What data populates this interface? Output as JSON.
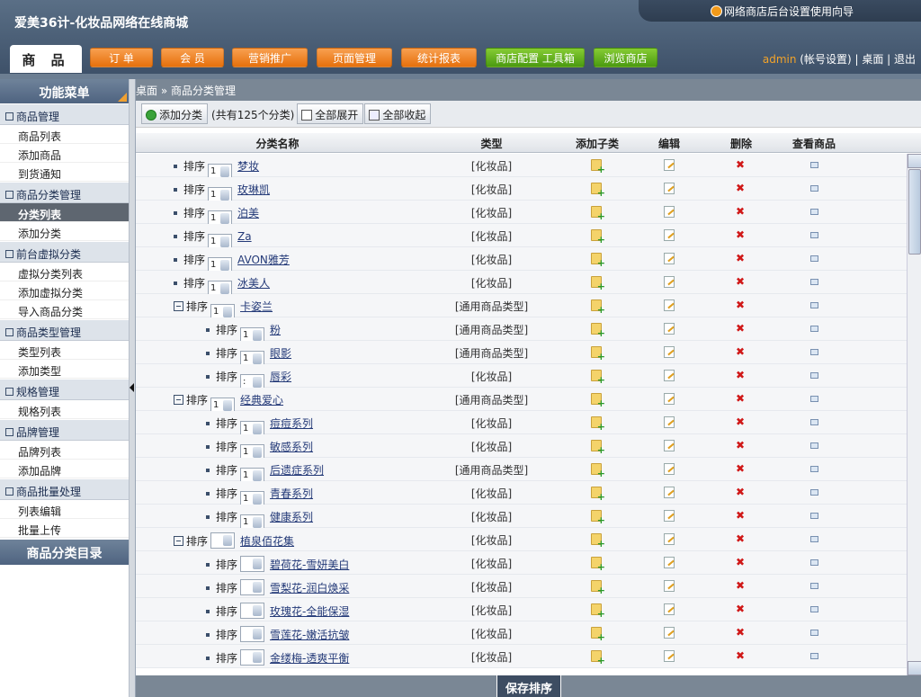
{
  "header": {
    "site_title": "爱美36计-化妆品网络在线商城",
    "guide_text": "网络商店后台设置使用向导",
    "active_tab": "商 品",
    "nav": [
      "订 单",
      "会 员",
      "营销推广",
      "页面管理",
      "统计报表",
      "商店配置 工具箱",
      "浏览商店"
    ],
    "user": "admin",
    "user_links": "(帐号设置) | 桌面 | 退出"
  },
  "sidebar": {
    "title": "功能菜单",
    "groups": [
      {
        "label": "商品管理",
        "items": [
          "商品列表",
          "添加商品",
          "到货通知"
        ]
      },
      {
        "label": "商品分类管理",
        "items": [
          "分类列表",
          "添加分类"
        ]
      },
      {
        "label": "前台虚拟分类",
        "items": [
          "虚拟分类列表",
          "添加虚拟分类",
          "导入商品分类"
        ]
      },
      {
        "label": "商品类型管理",
        "items": [
          "类型列表",
          "添加类型"
        ]
      },
      {
        "label": "规格管理",
        "items": [
          "规格列表"
        ]
      },
      {
        "label": "品牌管理",
        "items": [
          "品牌列表",
          "添加品牌"
        ]
      },
      {
        "label": "商品批量处理",
        "items": [
          "列表编辑",
          "批量上传"
        ]
      }
    ],
    "active_item": "分类列表",
    "footer_title": "商品分类目录"
  },
  "breadcrumb": "桌面 » 商品分类管理",
  "toolbar": {
    "add_label": "添加分类",
    "count": "(共有125个分类)",
    "expand_label": "全部展开",
    "collapse_label": "全部收起"
  },
  "table": {
    "headers": [
      "分类名称",
      "类型",
      "添加子类",
      "编辑",
      "删除",
      "查看商品"
    ],
    "sort_label": "排序",
    "rows": [
      {
        "name": "梦妆",
        "type": "[化妆品]",
        "level": 0,
        "sort": "1"
      },
      {
        "name": "玫琳凯",
        "type": "[化妆品]",
        "level": 0,
        "sort": "1"
      },
      {
        "name": "泊美",
        "type": "[化妆品]",
        "level": 0,
        "sort": "1"
      },
      {
        "name": "Za",
        "type": "[化妆品]",
        "level": 0,
        "sort": "1"
      },
      {
        "name": "AVON雅芳",
        "type": "[化妆品]",
        "level": 0,
        "sort": "1"
      },
      {
        "name": "冰美人",
        "type": "[化妆品]",
        "level": 0,
        "sort": "1"
      },
      {
        "name": "卡姿兰",
        "type": "[通用商品类型]",
        "level": 0,
        "sort": "1",
        "expanded": true
      },
      {
        "name": "粉",
        "type": "[通用商品类型]",
        "level": 1,
        "sort": "1"
      },
      {
        "name": "眼影",
        "type": "[通用商品类型]",
        "level": 1,
        "sort": "1"
      },
      {
        "name": "唇彩",
        "type": "[化妆品]",
        "level": 1,
        "sort": ":"
      },
      {
        "name": "经典爱心",
        "type": "[通用商品类型]",
        "level": 0,
        "sort": "1",
        "expanded": true
      },
      {
        "name": "痘痘系列",
        "type": "[化妆品]",
        "level": 1,
        "sort": "1"
      },
      {
        "name": "敏感系列",
        "type": "[化妆品]",
        "level": 1,
        "sort": "1"
      },
      {
        "name": "后遗症系列",
        "type": "[通用商品类型]",
        "level": 1,
        "sort": "1"
      },
      {
        "name": "青春系列",
        "type": "[化妆品]",
        "level": 1,
        "sort": "1"
      },
      {
        "name": "健康系列",
        "type": "[化妆品]",
        "level": 1,
        "sort": "1"
      },
      {
        "name": "植泉佰花集",
        "type": "[化妆品]",
        "level": 0,
        "sort": "",
        "expanded": true
      },
      {
        "name": "碧荷花-雪妍美白",
        "type": "[化妆品]",
        "level": 1,
        "sort": ""
      },
      {
        "name": "雪梨花-润白焕采",
        "type": "[化妆品]",
        "level": 1,
        "sort": ""
      },
      {
        "name": "玫瑰花-全能保湿",
        "type": "[化妆品]",
        "level": 1,
        "sort": ""
      },
      {
        "name": "雪莲花-嫩活抗皱",
        "type": "[化妆品]",
        "level": 1,
        "sort": ""
      },
      {
        "name": "金缕梅-透爽平衡",
        "type": "[化妆品]",
        "level": 1,
        "sort": ""
      }
    ]
  },
  "save_label": "保存排序"
}
